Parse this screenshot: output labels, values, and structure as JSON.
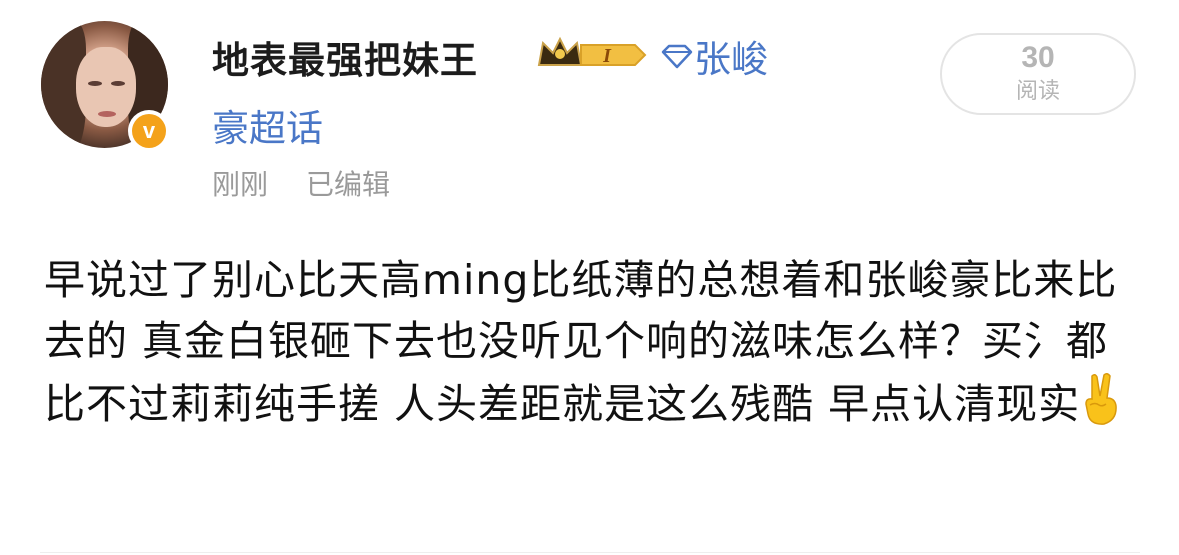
{
  "post": {
    "username": "地表最强把妹王",
    "topic_tag_part1": "张峻",
    "topic_tag_part2": "豪超话",
    "time": "刚刚",
    "edited": "已编辑",
    "read_count": "30",
    "read_label": "阅读",
    "content_text": "早说过了别心比天高ming比纸薄的总想着和张峻豪比来比去的 真金白银砸下去也没听见个响的滋味怎么样？买氵都比不过莉莉纯手搓 人头差距就是这么残酷 早点认清现实",
    "emoji": "victory-hand-emoji"
  },
  "badges": {
    "verified_letter": "v",
    "level": "I"
  },
  "colors": {
    "username": "#1c1c1c",
    "topic_link": "#4a77c7",
    "meta": "#9a9a9a",
    "verified_badge": "#f4a21a",
    "read_pill_border": "#e4e4e4"
  }
}
